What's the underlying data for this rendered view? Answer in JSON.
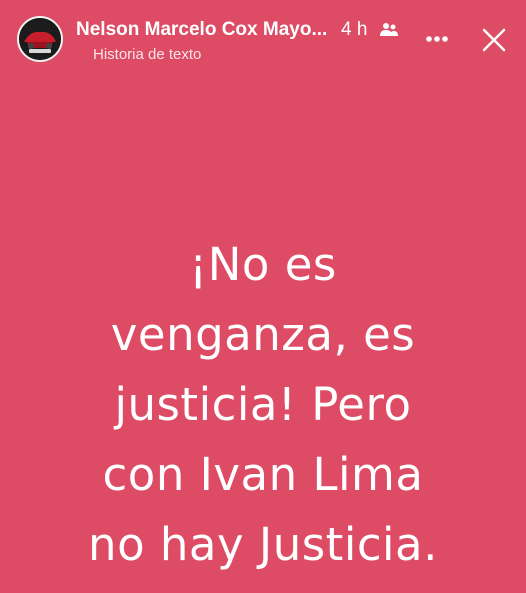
{
  "story": {
    "author": "Nelson Marcelo Cox Mayo...",
    "time": "4 h",
    "subtitle": "Historia de texto",
    "audience_icon": "friends-icon",
    "background_color": "#dd4b64",
    "text_lines": [
      "¡No es",
      "venganza, es",
      "justicia! Pero",
      "con Ivan Lima",
      "no hay Justicia."
    ]
  },
  "controls": {
    "more_icon": "more-dots-icon",
    "close_icon": "close-icon"
  }
}
